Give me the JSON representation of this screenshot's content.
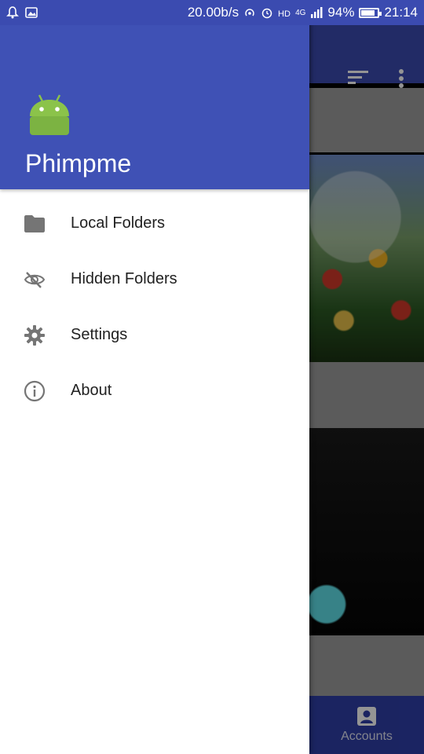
{
  "status_bar": {
    "speed": "20.00b/s",
    "network": "4G",
    "battery": "94%",
    "time": "21:14"
  },
  "drawer": {
    "app_name": "Phimpme",
    "items": [
      {
        "label": "Local Folders",
        "icon": "folder-icon"
      },
      {
        "label": "Hidden Folders",
        "icon": "eye-off-icon"
      },
      {
        "label": "Settings",
        "icon": "gear-icon"
      },
      {
        "label": "About",
        "icon": "info-icon"
      }
    ]
  },
  "background": {
    "bottom_nav_label": "Accounts"
  },
  "colors": {
    "primary": "#3f51b5",
    "android_green": "#8bc34a"
  },
  "battery_level": 0.94
}
